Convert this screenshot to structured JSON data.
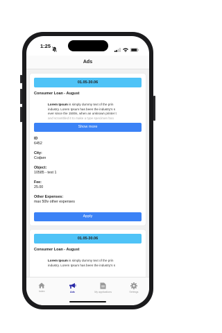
{
  "status": {
    "time": "1:25",
    "bell_icon": "bell-slash-icon",
    "signal_icon": "cellular-signal-icon",
    "wifi_icon": "wifi-icon",
    "battery_icon": "battery-icon"
  },
  "header": {
    "title": "Ads"
  },
  "cards": [
    {
      "date_range": "01.05-30.06",
      "title": "Consumer Loan - August",
      "description": {
        "bold": "Lorem Ipsum",
        "lines": [
          " is simply dummy text of the prin",
          "industry. Lorem Ipsum has been the industry's s",
          "ever since the 1500s, when an unknown printer t",
          "and scrambled it to make a type specimen boo"
        ]
      },
      "show_more_label": "Show more",
      "fields": [
        {
          "label": "ID",
          "value": "6452"
        },
        {
          "label": "City:",
          "value": "София"
        },
        {
          "label": "Object:",
          "value": "10585 - test 1"
        },
        {
          "label": "Fee:",
          "value": "25.00"
        },
        {
          "label": "Other Expenses:",
          "value": "max 50lv other expenses"
        }
      ],
      "apply_label": "Apply"
    },
    {
      "date_range": "01.05-30.06",
      "title": "Consumer Loan - August",
      "description": {
        "bold": "Lorem Ipsum",
        "lines": [
          " is simply dummy text of the prin",
          "industry. Lorem Ipsum has been the industry's s"
        ]
      }
    }
  ],
  "tabs": [
    {
      "label": "Index",
      "icon": "home-icon",
      "active": false
    },
    {
      "label": "Ads",
      "icon": "megaphone-icon",
      "active": true
    },
    {
      "label": "My applications",
      "icon": "document-icon",
      "active": false
    },
    {
      "label": "Settings",
      "icon": "gear-icon",
      "active": false
    }
  ],
  "colors": {
    "accent": "#3b82f6",
    "date_bar": "#4fc3f7",
    "active_tab": "#2a2aa8",
    "inactive_tab": "#999999"
  }
}
